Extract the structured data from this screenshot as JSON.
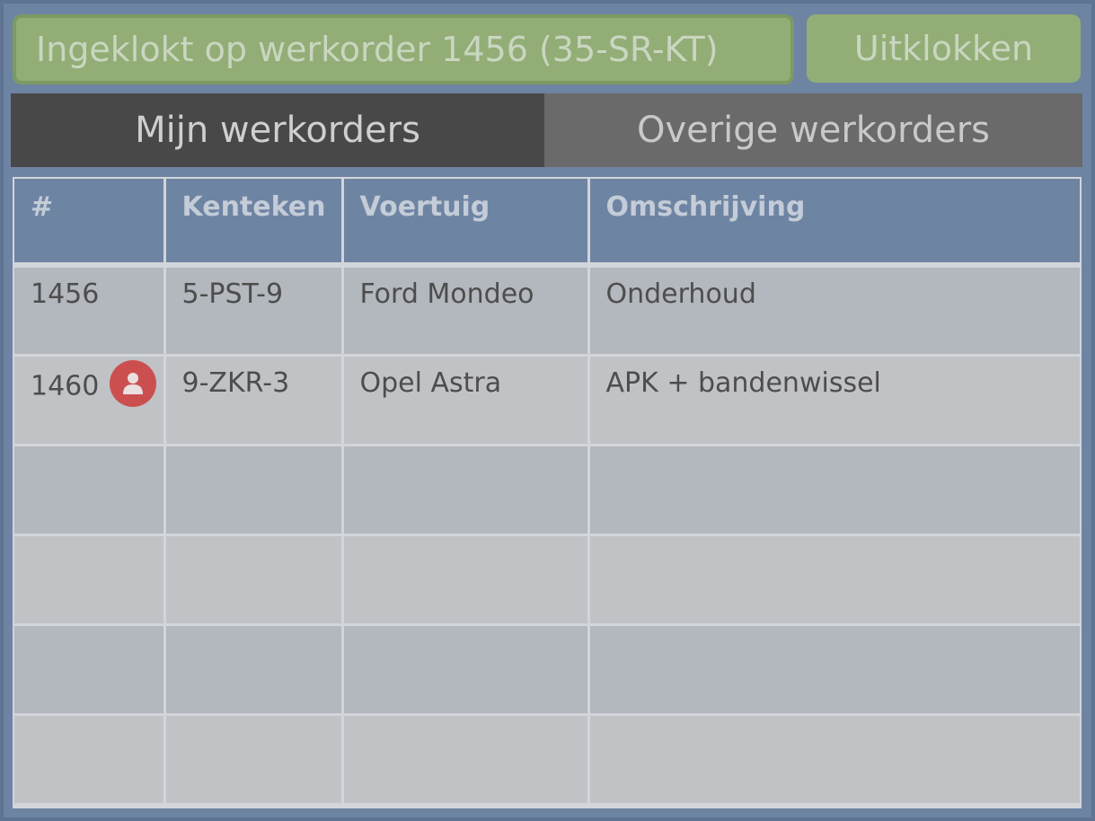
{
  "status": {
    "text": "Ingeklokt op werkorder 1456 (35-SR-KT)"
  },
  "actions": {
    "clock_out_label": "Uitklokken"
  },
  "tabs": [
    {
      "label": "Mijn werkorders",
      "active": true
    },
    {
      "label": "Overige werkorders",
      "active": false
    }
  ],
  "table": {
    "columns": [
      "#",
      "Kenteken",
      "Voertuig",
      "Omschrijving"
    ],
    "rows": [
      {
        "nr": "1456",
        "kenteken": "5-PST-9",
        "voertuig": "Ford Mondeo",
        "omschrijving": "Onderhoud",
        "assigned_user": false
      },
      {
        "nr": "1460",
        "kenteken": "9-ZKR-3",
        "voertuig": "Opel Astra",
        "omschrijving": "APK + bandenwissel",
        "assigned_user": true
      },
      {
        "nr": "",
        "kenteken": "",
        "voertuig": "",
        "omschrijving": "",
        "assigned_user": false
      },
      {
        "nr": "",
        "kenteken": "",
        "voertuig": "",
        "omschrijving": "",
        "assigned_user": false
      },
      {
        "nr": "",
        "kenteken": "",
        "voertuig": "",
        "omschrijving": "",
        "assigned_user": false
      },
      {
        "nr": "",
        "kenteken": "",
        "voertuig": "",
        "omschrijving": "",
        "assigned_user": false
      }
    ]
  },
  "icons": {
    "user_badge": "user-icon"
  },
  "colors": {
    "status_green": "#93ad76",
    "badge_red": "#cc4f50",
    "header_blue": "#6e84a3"
  }
}
